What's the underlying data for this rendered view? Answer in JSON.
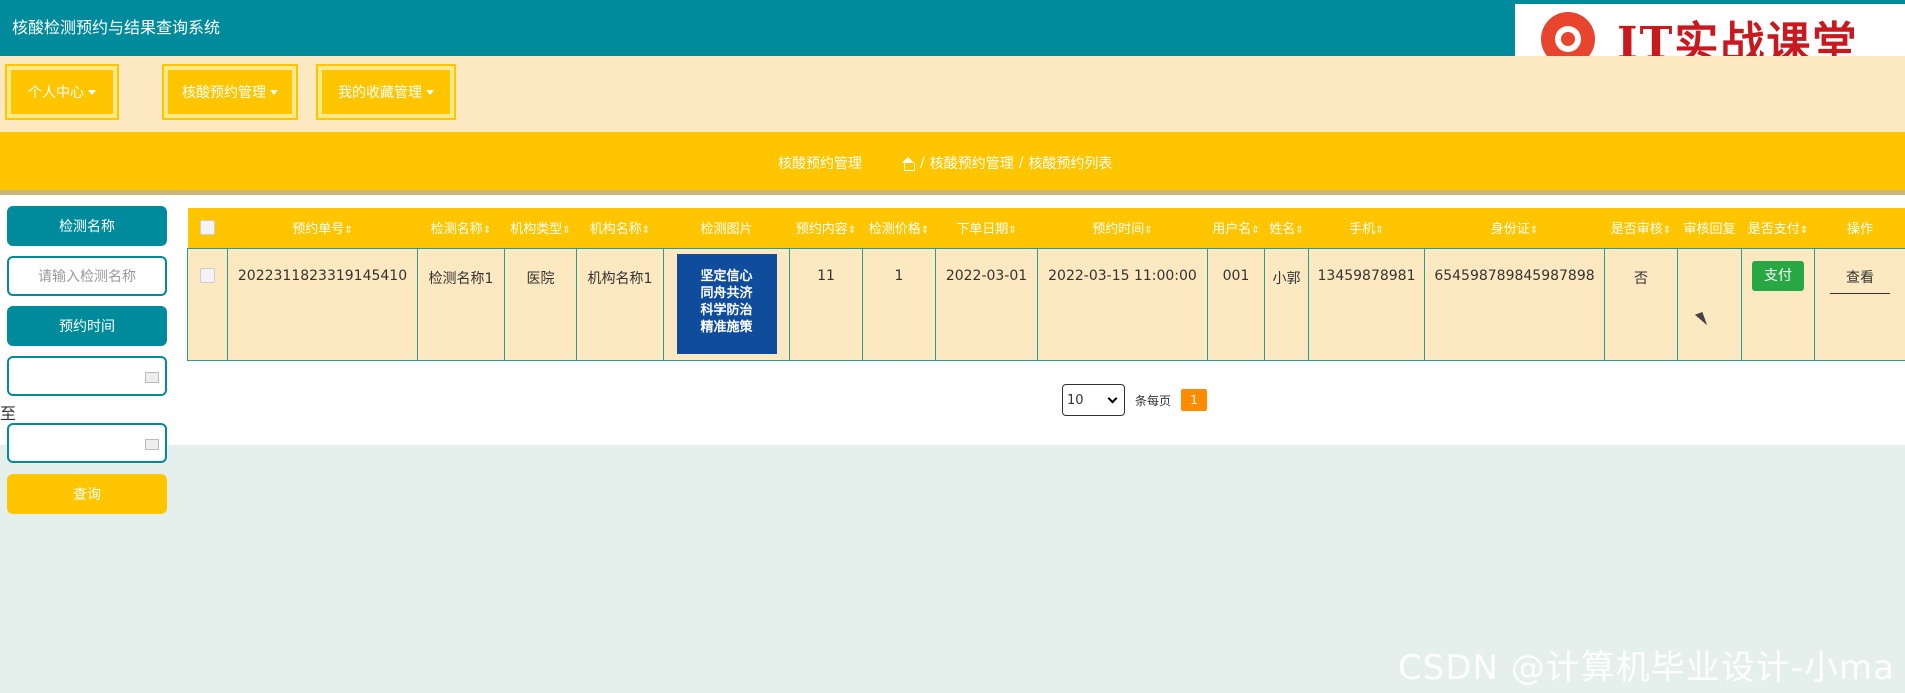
{
  "app_title": "核酸检测预约与结果查询系统",
  "brand_text": "IT实战课堂",
  "nav": [
    {
      "label": "个人中心"
    },
    {
      "label": "核酸预约管理"
    },
    {
      "label": "我的收藏管理"
    }
  ],
  "breadcrumb": {
    "title": "核酸预约管理",
    "trail": [
      "核酸预约管理",
      "核酸预约列表"
    ],
    "separator": "/"
  },
  "sidebar": {
    "name_label": "检测名称",
    "name_placeholder": "请输入检测名称",
    "time_label": "预约时间",
    "to_label": "至",
    "search_label": "查询"
  },
  "table": {
    "headers": [
      "预约单号",
      "检测名称",
      "机构类型",
      "机构名称",
      "检测图片",
      "预约内容",
      "检测价格",
      "下单日期",
      "预约时间",
      "用户名",
      "姓名",
      "手机",
      "身份证",
      "是否审核",
      "审核回复",
      "是否支付",
      "操作"
    ],
    "rows": [
      {
        "order_no": "2022311823319145410",
        "test_name": "检测名称1",
        "org_type": "医院",
        "org_name": "机构名称1",
        "image_text": [
          "坚定信心",
          "同舟共济",
          "科学防治",
          "精准施策"
        ],
        "content": "11",
        "price": "1",
        "order_date": "2022-03-01",
        "appt_time": "2022-03-15 11:00:00",
        "username": "001",
        "name": "小郭",
        "phone": "13459878981",
        "id_card": "654598789845987898",
        "reviewed": "否",
        "reply": "",
        "pay_label": "支付",
        "view_label": "查看"
      }
    ]
  },
  "pager": {
    "page_size": "10",
    "per_page_label": "条每页",
    "current_page": "1"
  },
  "watermark": "CSDN @计算机毕业设计-小ma",
  "colors": {
    "teal": "#008b9c",
    "amber": "#ffc600",
    "cream": "#fde9c1",
    "pay_green": "#28a745",
    "page_orange": "#ff8c00"
  }
}
